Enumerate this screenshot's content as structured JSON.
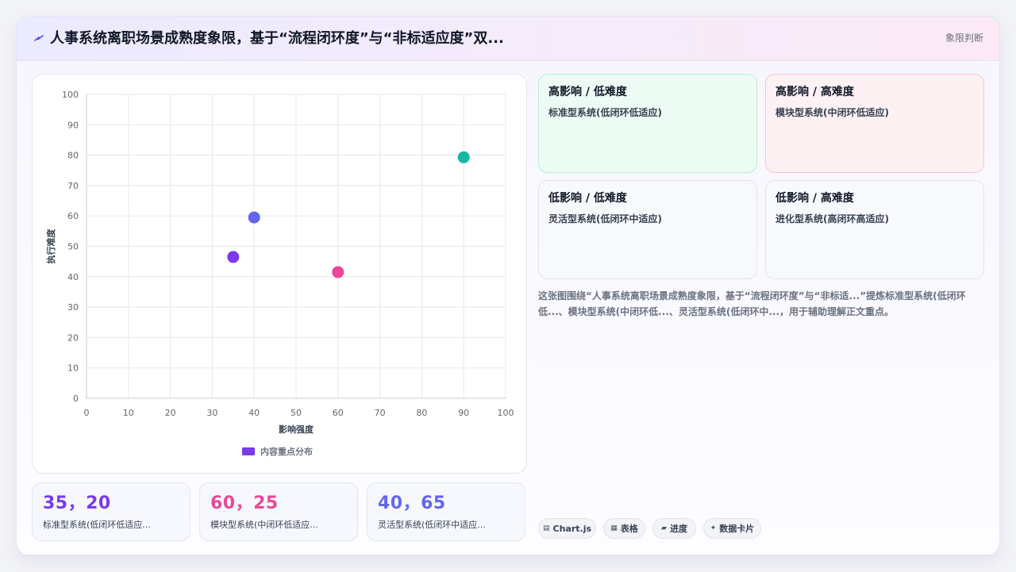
{
  "header": {
    "title": "人事系统离职场景成熟度象限，基于“流程闭环度”与“非标适应度”双...",
    "tag": "象限判断",
    "icon": "lightning-icon"
  },
  "chart_data": {
    "type": "scatter",
    "xlabel": "影响强度",
    "ylabel": "执行难度",
    "xlim": [
      0,
      100
    ],
    "ylim": [
      0,
      100
    ],
    "xticks": [
      "0",
      "10",
      "20",
      "30",
      "40",
      "50",
      "60",
      "70",
      "80",
      "90",
      "100"
    ],
    "yticks": [
      "0",
      "10",
      "20",
      "30",
      "40",
      "50",
      "60",
      "70",
      "80",
      "90",
      "100"
    ],
    "grid": true,
    "legend": {
      "label": "内容重点分布",
      "color": "#7c3aed",
      "position": "bottom"
    },
    "points": [
      {
        "x": 35,
        "y": 46.5,
        "color": "#7c3aed"
      },
      {
        "x": 40,
        "y": 59.5,
        "color": "#6366f1"
      },
      {
        "x": 60,
        "y": 41.5,
        "color": "#ec4899"
      },
      {
        "x": 90,
        "y": 79.3,
        "color": "#14b8a6"
      }
    ]
  },
  "stats": [
    {
      "value": "35，20",
      "label": "标准型系统(低闭环低适应...",
      "color": "#7c3aed"
    },
    {
      "value": "60，25",
      "label": "模块型系统(中闭环低适应...",
      "color": "#ec4899"
    },
    {
      "value": "40，65",
      "label": "灵活型系统(低闭环中适应...",
      "color": "#6366f1"
    }
  ],
  "quadrants": [
    {
      "title": "高影响 / 低难度",
      "sub": "标准型系统(低闭环低适应)"
    },
    {
      "title": "高影响 / 高难度",
      "sub": "模块型系统(中闭环低适应)"
    },
    {
      "title": "低影响 / 低难度",
      "sub": "灵活型系统(低闭环中适应)"
    },
    {
      "title": "低影响 / 高难度",
      "sub": "进化型系统(高闭环高适应)"
    }
  ],
  "description": "这张图围绕“人事系统离职场景成熟度象限，基于“流程闭环度”与“非标适...”提炼标准型系统(低闭环低...、模块型系统(中闭环低...、灵活型系统(低闭环中...，用于辅助理解正文重点。",
  "chips": [
    {
      "icon": "▤",
      "label": "Chart.js"
    },
    {
      "icon": "▦",
      "label": "表格"
    },
    {
      "icon": "▰",
      "label": "进度"
    },
    {
      "icon": "✦",
      "label": "数据卡片"
    }
  ]
}
